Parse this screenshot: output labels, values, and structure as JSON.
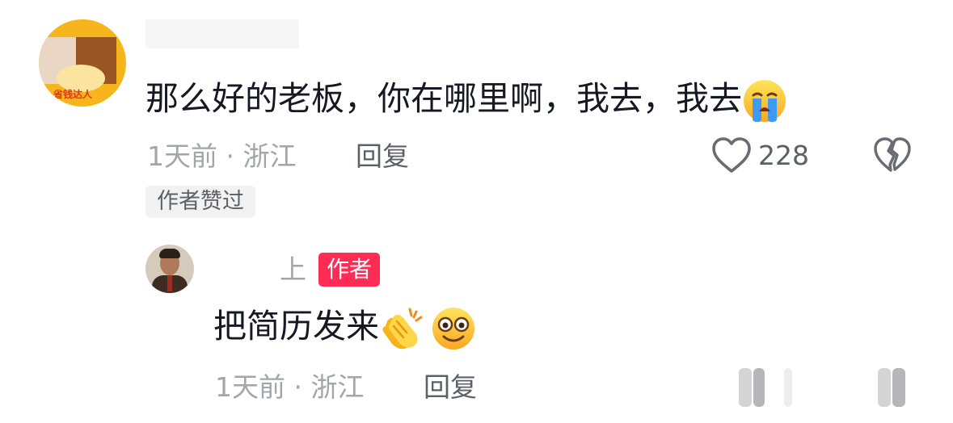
{
  "comment": {
    "avatar_badge": "省钱达人",
    "text": "那么好的老板，你在哪里啊，我去，我去",
    "emoji": "crying-face-emoji",
    "time_location": "1天前 · 浙江",
    "reply_label": "回复",
    "like_count": "228",
    "author_liked_badge": "作者赞过"
  },
  "reply": {
    "username": "上",
    "author_tag": "作者",
    "text": "把简历发来",
    "emojis": [
      "clapping-hands-emoji",
      "smiling-face-emoji"
    ],
    "time_location": "1天前 · 浙江",
    "reply_label": "回复"
  },
  "colors": {
    "text_primary": "#161823",
    "text_secondary": "#a4a5ab",
    "reply_link": "#5e6068",
    "author_tag_bg": "#fe2c55",
    "badge_bg": "#f2f2f2"
  }
}
